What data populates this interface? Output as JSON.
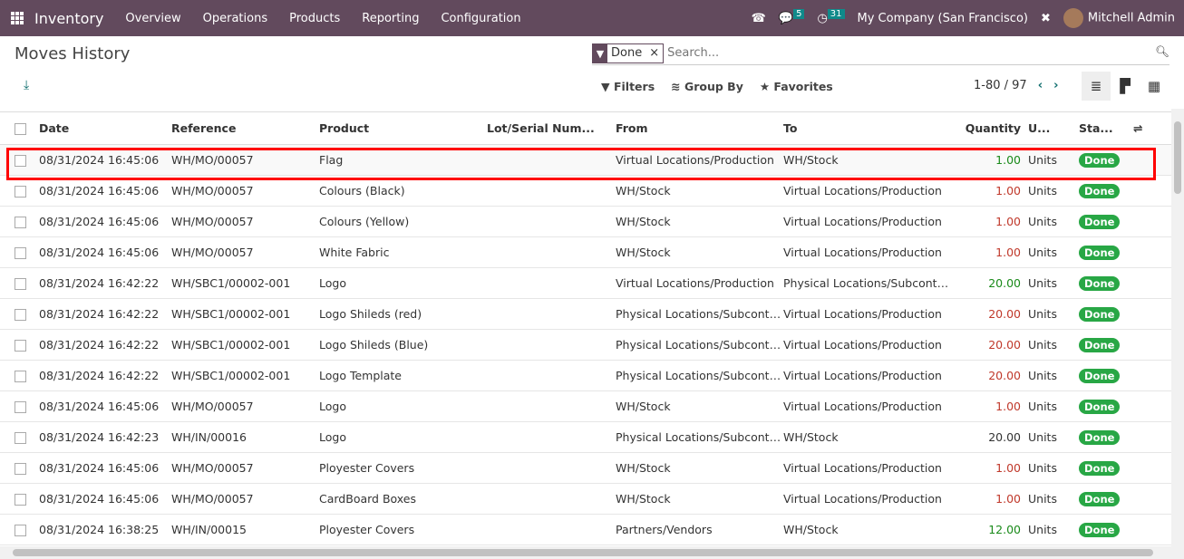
{
  "nav": {
    "brand": "Inventory",
    "menus": [
      "Overview",
      "Operations",
      "Products",
      "Reporting",
      "Configuration"
    ],
    "messages_count": "5",
    "activities_count": "31",
    "company": "My Company (San Francisco)",
    "user": "Mitchell Admin"
  },
  "page": {
    "title": "Moves History"
  },
  "search": {
    "facet": "Done",
    "placeholder": "Search..."
  },
  "toolbar": {
    "filters": "Filters",
    "group_by": "Group By",
    "favorites": "Favorites"
  },
  "pager": {
    "range": "1-80 / 97"
  },
  "colors": {
    "navbar": "#624a5d",
    "done_badge": "#28a745",
    "positive_qty": "#1a8a1a",
    "negative_qty": "#c0392b"
  },
  "table": {
    "headers": [
      "Date",
      "Reference",
      "Product",
      "Lot/Serial Num...",
      "From",
      "To",
      "Quantity",
      "U...",
      "Sta..."
    ],
    "rows": [
      [
        "08/31/2024 16:45:06",
        "WH/MO/00057",
        "Flag",
        "",
        "Virtual Locations/Production",
        "WH/Stock",
        "1.00",
        "Units",
        "Done",
        "pos"
      ],
      [
        "08/31/2024 16:45:06",
        "WH/MO/00057",
        "Colours (Black)",
        "",
        "WH/Stock",
        "Virtual Locations/Production",
        "1.00",
        "Units",
        "Done",
        "neg"
      ],
      [
        "08/31/2024 16:45:06",
        "WH/MO/00057",
        "Colours (Yellow)",
        "",
        "WH/Stock",
        "Virtual Locations/Production",
        "1.00",
        "Units",
        "Done",
        "neg"
      ],
      [
        "08/31/2024 16:45:06",
        "WH/MO/00057",
        "White Fabric",
        "",
        "WH/Stock",
        "Virtual Locations/Production",
        "1.00",
        "Units",
        "Done",
        "neg"
      ],
      [
        "08/31/2024 16:42:22",
        "WH/SBC1/00002-001",
        "Logo",
        "",
        "Virtual Locations/Production",
        "Physical Locations/Subcontr...",
        "20.00",
        "Units",
        "Done",
        "pos"
      ],
      [
        "08/31/2024 16:42:22",
        "WH/SBC1/00002-001",
        "Logo Shileds (red)",
        "",
        "Physical Locations/Subcontr...",
        "Virtual Locations/Production",
        "20.00",
        "Units",
        "Done",
        "neg"
      ],
      [
        "08/31/2024 16:42:22",
        "WH/SBC1/00002-001",
        "Logo Shileds (Blue)",
        "",
        "Physical Locations/Subcontr...",
        "Virtual Locations/Production",
        "20.00",
        "Units",
        "Done",
        "neg"
      ],
      [
        "08/31/2024 16:42:22",
        "WH/SBC1/00002-001",
        "Logo Template",
        "",
        "Physical Locations/Subcontr...",
        "Virtual Locations/Production",
        "20.00",
        "Units",
        "Done",
        "neg"
      ],
      [
        "08/31/2024 16:45:06",
        "WH/MO/00057",
        "Logo",
        "",
        "WH/Stock",
        "Virtual Locations/Production",
        "1.00",
        "Units",
        "Done",
        "neg"
      ],
      [
        "08/31/2024 16:42:23",
        "WH/IN/00016",
        "Logo",
        "",
        "Physical Locations/Subcontr...",
        "WH/Stock",
        "20.00",
        "Units",
        "Done",
        "neu"
      ],
      [
        "08/31/2024 16:45:06",
        "WH/MO/00057",
        "Ployester Covers",
        "",
        "WH/Stock",
        "Virtual Locations/Production",
        "1.00",
        "Units",
        "Done",
        "neg"
      ],
      [
        "08/31/2024 16:45:06",
        "WH/MO/00057",
        "CardBoard Boxes",
        "",
        "WH/Stock",
        "Virtual Locations/Production",
        "1.00",
        "Units",
        "Done",
        "neg"
      ],
      [
        "08/31/2024 16:38:25",
        "WH/IN/00015",
        "Ployester Covers",
        "",
        "Partners/Vendors",
        "WH/Stock",
        "12.00",
        "Units",
        "Done",
        "pos"
      ]
    ]
  }
}
